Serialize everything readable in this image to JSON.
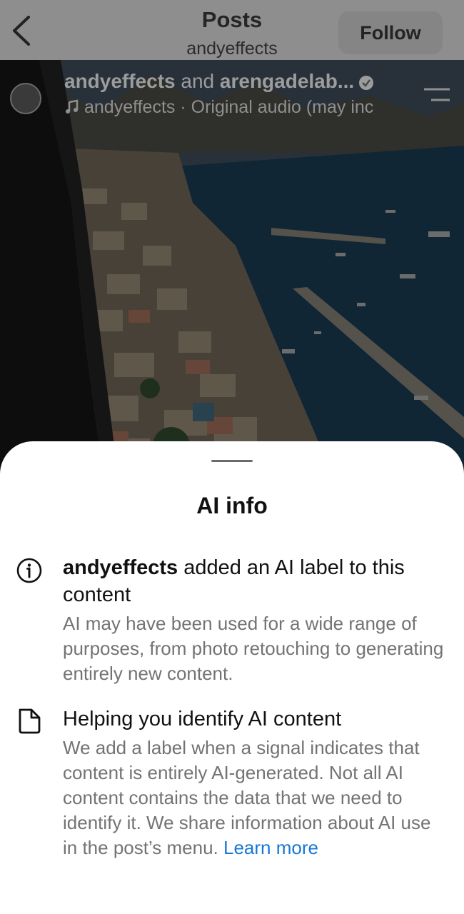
{
  "header": {
    "title": "Posts",
    "subtitle": "andyeffects",
    "follow_label": "Follow",
    "back_icon": "chevron-left-icon"
  },
  "post": {
    "author_primary": "andyeffects",
    "author_connector": " and ",
    "author_secondary": "arengadelab...",
    "audio_text": "andyeffects · Original audio (may inc",
    "verified_icon": "verified-badge-icon",
    "music_icon": "music-note-icon",
    "menu_icon": "menu-lines-icon"
  },
  "sheet": {
    "title": "AI info",
    "item1": {
      "icon": "info-circle-icon",
      "heading_bold": "andyeffects",
      "heading_rest": " added an AI label to this content",
      "description": "AI may have been used for a wide range of purposes, from photo retouching to generating entirely new content."
    },
    "item2": {
      "icon": "document-icon",
      "heading": "Helping you identify AI content",
      "description": "We add a label when a signal indicates that content is entirely AI-generated. Not all AI content contains the data that we need to identify it. We share information about AI use in the post’s menu. ",
      "link": "Learn more"
    }
  },
  "colors": {
    "link": "#1877d4",
    "secondary_text": "#737373",
    "primary_text": "#111111"
  }
}
